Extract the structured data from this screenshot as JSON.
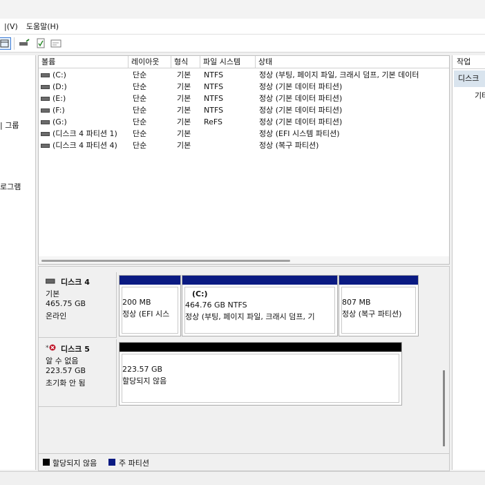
{
  "menu": {
    "action_suffix": "|(V)",
    "help": "도움말(H)"
  },
  "left_tree": {
    "item_group": "| 그룹",
    "item_program": "로그램"
  },
  "columns": [
    "볼륨",
    "레이아웃",
    "형식",
    "파일 시스템",
    "상태"
  ],
  "volumes": [
    {
      "name": "(C:)",
      "layout": "단순",
      "type": "기본",
      "fs": "NTFS",
      "status": "정상 (부팅, 페이지 파일, 크래시 덤프, 기본 데이터"
    },
    {
      "name": "(D:)",
      "layout": "단순",
      "type": "기본",
      "fs": "NTFS",
      "status": "정상 (기본 데이터 파티션)"
    },
    {
      "name": "(E:)",
      "layout": "단순",
      "type": "기본",
      "fs": "NTFS",
      "status": "정상 (기본 데이터 파티션)"
    },
    {
      "name": "(F:)",
      "layout": "단순",
      "type": "기본",
      "fs": "NTFS",
      "status": "정상 (기본 데이터 파티션)"
    },
    {
      "name": "(G:)",
      "layout": "단순",
      "type": "기본",
      "fs": "ReFS",
      "status": "정상 (기본 데이터 파티션)"
    },
    {
      "name": "(디스크 4 파티션 1)",
      "layout": "단순",
      "type": "기본",
      "fs": "",
      "status": "정상 (EFI 시스템 파티션)"
    },
    {
      "name": "(디스크 4 파티션 4)",
      "layout": "단순",
      "type": "기본",
      "fs": "",
      "status": "정상 (복구 파티션)"
    }
  ],
  "disks": [
    {
      "name": "디스크 4",
      "kind": "기본",
      "size": "465.75 GB",
      "state": "온라인",
      "partitions": [
        {
          "label": "",
          "size": "200 MB",
          "status": "정상 (EFI 시스"
        },
        {
          "label": "(C:)",
          "size": "464.76 GB NTFS",
          "status": "정상 (부팅, 페이지 파일, 크래시 덤프, 기"
        },
        {
          "label": "",
          "size": "807 MB",
          "status": "정상 (복구 파티션)"
        }
      ]
    },
    {
      "name": "디스크 5",
      "kind": "알 수 없음",
      "size": "223.57 GB",
      "state": "초기화 안 됨",
      "partitions": [
        {
          "label": "",
          "size": "223.57 GB",
          "status": "할당되지 않음"
        }
      ]
    }
  ],
  "legend": {
    "unallocated": "할당되지 않음",
    "primary": "주 파티션"
  },
  "actions": {
    "header": "작업",
    "selected": "디스크",
    "sub": "기타"
  },
  "colors": {
    "primary_partition": "#0a1a82",
    "unallocated": "#000000",
    "selection": "#d9e4ee"
  }
}
